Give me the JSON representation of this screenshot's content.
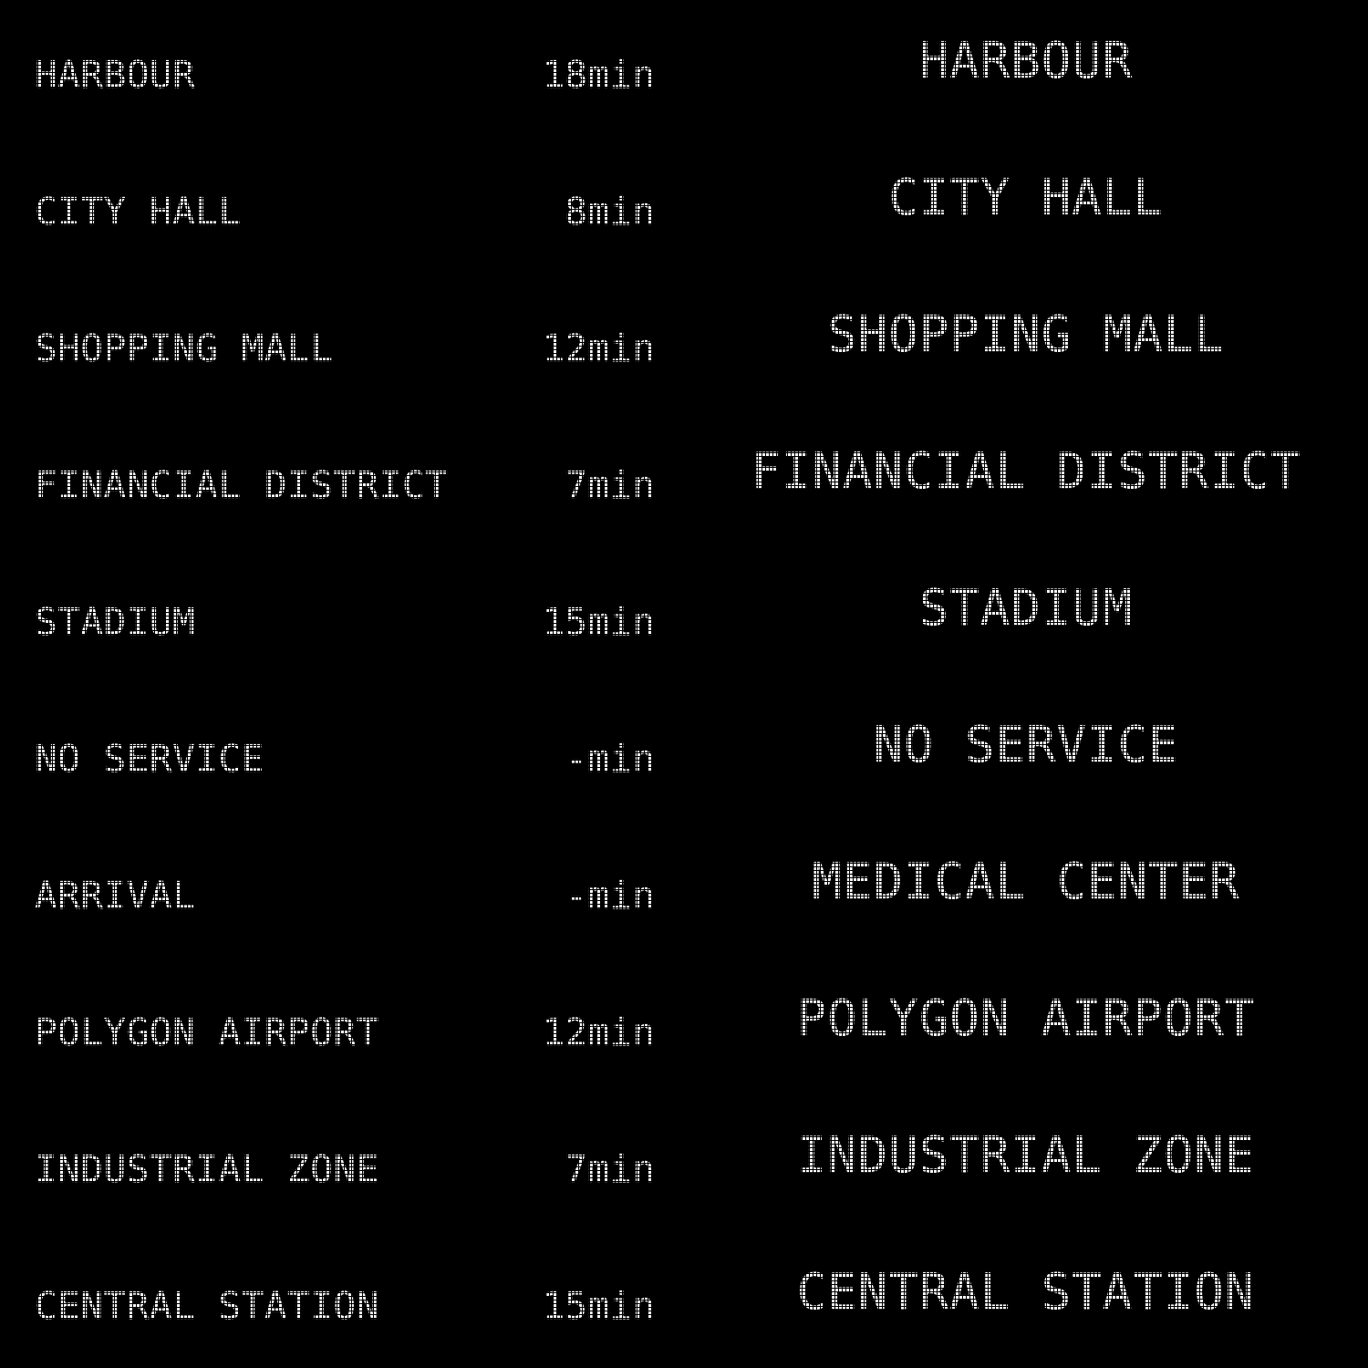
{
  "board": {
    "rows": [
      {
        "destination": "HARBOUR",
        "eta": "18min",
        "display": "HARBOUR"
      },
      {
        "destination": "CITY HALL",
        "eta": "8min",
        "display": "CITY HALL"
      },
      {
        "destination": "SHOPPING MALL",
        "eta": "12min",
        "display": "SHOPPING MALL"
      },
      {
        "destination": "FINANCIAL DISTRICT",
        "eta": "7min",
        "display": "FINANCIAL DISTRICT"
      },
      {
        "destination": "STADIUM",
        "eta": "15min",
        "display": "STADIUM"
      },
      {
        "destination": "NO SERVICE",
        "eta": "-min",
        "display": "NO SERVICE"
      },
      {
        "destination": "ARRIVAL",
        "eta": "-min",
        "display": "MEDICAL CENTER"
      },
      {
        "destination": "POLYGON AIRPORT",
        "eta": "12min",
        "display": "POLYGON AIRPORT"
      },
      {
        "destination": "INDUSTRIAL ZONE",
        "eta": "7min",
        "display": "INDUSTRIAL ZONE"
      },
      {
        "destination": "CENTRAL STATION",
        "eta": "15min",
        "display": "CENTRAL STATION"
      }
    ]
  },
  "colors": {
    "background": "#000000",
    "text": "#ffffff"
  }
}
